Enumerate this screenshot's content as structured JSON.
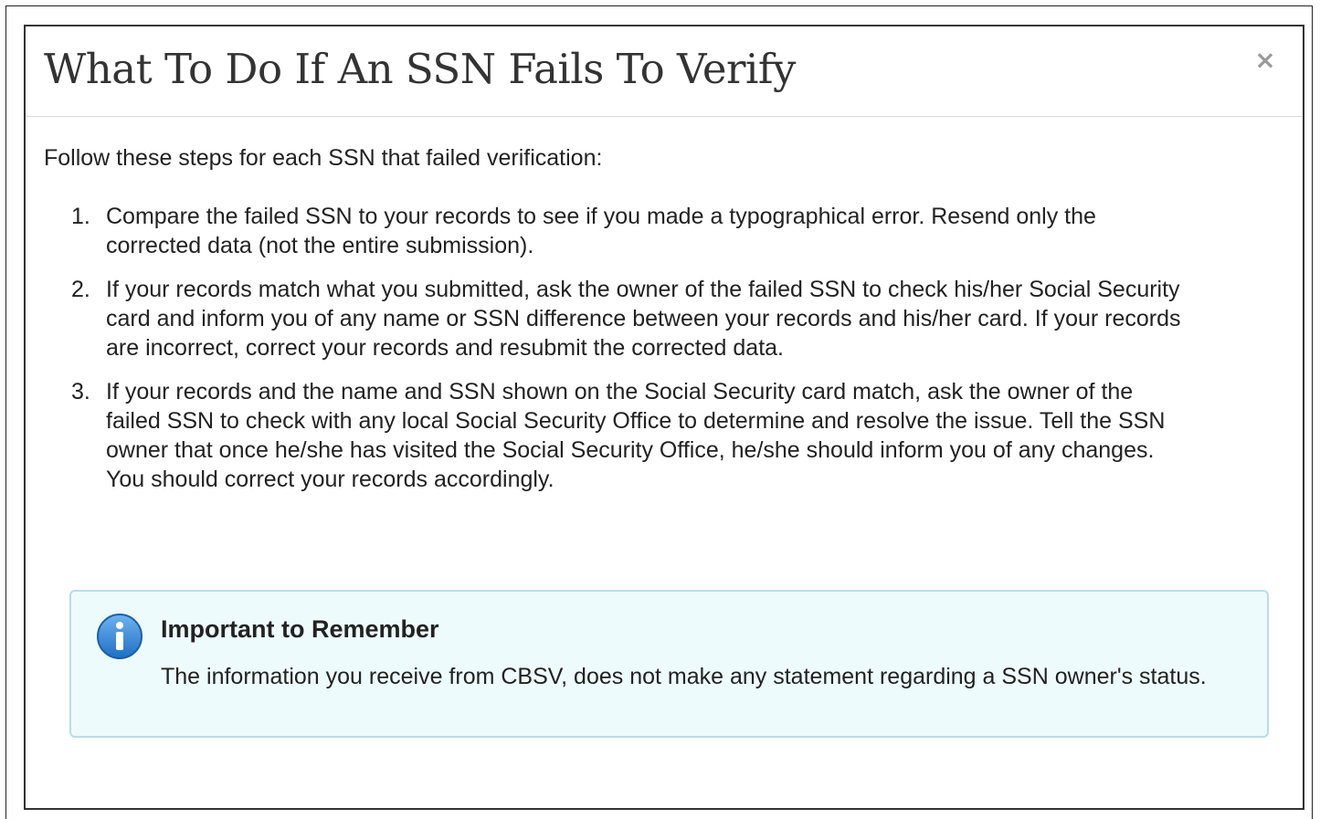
{
  "dialog": {
    "title": "What To Do If An SSN Fails To Verify",
    "close_label": "×",
    "close_icon": "close-icon"
  },
  "body": {
    "intro": "Follow these steps for each SSN that failed verification:",
    "steps": [
      {
        "number": "1.",
        "text": "Compare the failed SSN to your records to see if you made a typographical error. Resend only the corrected data (not the entire submission)."
      },
      {
        "number": "2.",
        "text": "If your records match what you submitted, ask the owner of the failed SSN to check his/her Social Security card and inform you of any name or SSN difference between your records and his/her card. If your records are incorrect, correct your records and resubmit the corrected data."
      },
      {
        "number": "3.",
        "text": "If your records and the name and SSN shown on the Social Security card match, ask the owner of the failed SSN to check with any local Social Security Office to determine and resolve the issue. Tell the SSN owner that once he/she has visited the Social Security Office, he/she should inform you of any changes. You should correct your records accordingly."
      }
    ]
  },
  "alert": {
    "icon": "info-icon",
    "title": "Important to Remember",
    "text": "The information you receive from CBSV, does not make any statement regarding a SSN owner's status."
  },
  "colors": {
    "alert_background": "#eefbfd",
    "alert_border": "#b8dde5",
    "info_icon_blue": "#2a7fd4"
  }
}
